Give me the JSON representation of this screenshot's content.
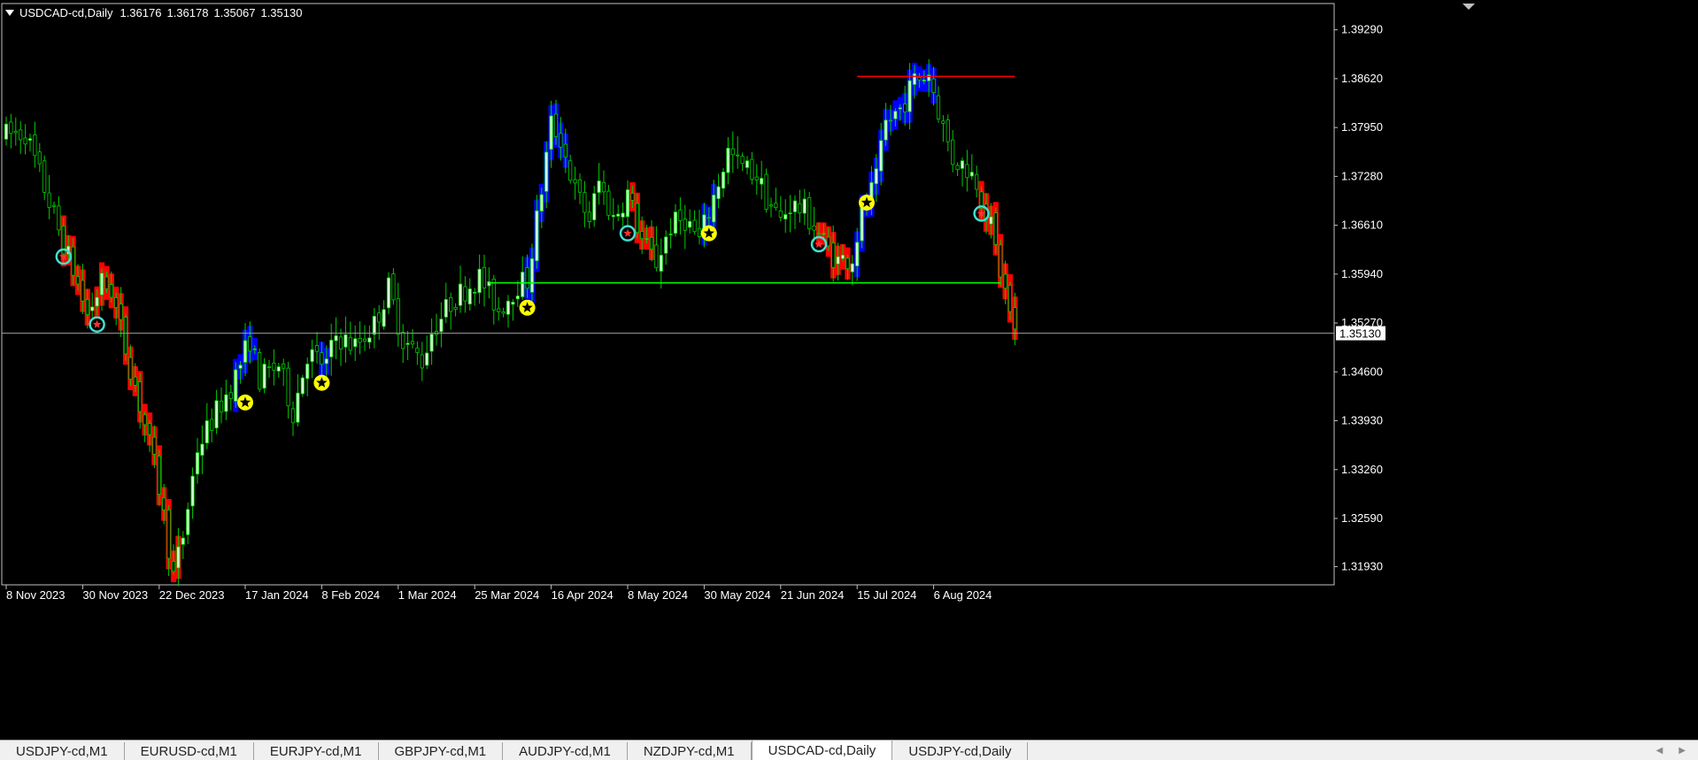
{
  "header": {
    "symbol": "USDCAD-cd,Daily",
    "open": "1.36176",
    "high": "1.36178",
    "low": "1.35067",
    "close": "1.35130"
  },
  "price_axis": {
    "labels": [
      "1.39290",
      "1.38620",
      "1.37950",
      "1.37280",
      "1.36610",
      "1.35940",
      "1.35270",
      "1.34600",
      "1.33930",
      "1.33260",
      "1.32590",
      "1.31930"
    ],
    "current_price": "1.35130"
  },
  "time_axis": {
    "labels": [
      "8 Nov 2023",
      "30 Nov 2023",
      "22 Dec 2023",
      "17 Jan 2024",
      "8 Feb 2024",
      "1 Mar 2024",
      "25 Mar 2024",
      "16 Apr 2024",
      "8 May 2024",
      "30 May 2024",
      "21 Jun 2024",
      "15 Jul 2024",
      "6 Aug 2024"
    ]
  },
  "tabs": [
    {
      "label": "USDJPY-cd,M1",
      "active": false
    },
    {
      "label": "EURUSD-cd,M1",
      "active": false
    },
    {
      "label": "EURJPY-cd,M1",
      "active": false
    },
    {
      "label": "GBPJPY-cd,M1",
      "active": false
    },
    {
      "label": "AUDJPY-cd,M1",
      "active": false
    },
    {
      "label": "NZDJPY-cd,M1",
      "active": false
    },
    {
      "label": "USDCAD-cd,Daily",
      "active": true
    },
    {
      "label": "USDJPY-cd,Daily",
      "active": false
    }
  ],
  "tab_scroll": {
    "left_icon": "◀",
    "right_icon": "▶"
  },
  "colors": {
    "bull_candle": "#ccffcc",
    "bear_candle": "#000000",
    "wick": "#00cc00",
    "up_zone": "#0000ff",
    "down_zone": "#ff0000",
    "support_line": "#00ff00",
    "resistance_line": "#ff0000",
    "price_line": "#a0a0a0",
    "buy_signal": "#ffff00",
    "sell_signal": "#40e0d0"
  },
  "chart_data": {
    "type": "candlestick",
    "symbol": "USDCAD-cd",
    "timeframe": "Daily",
    "ylim": [
      1.3168,
      1.3965
    ],
    "date_range": [
      "2023-11-08",
      "2024-08-29"
    ],
    "anchors": [
      [
        "2023-11-08",
        1.3785
      ],
      [
        "2023-11-14",
        1.3788
      ],
      [
        "2023-11-20",
        1.3712
      ],
      [
        "2023-11-24",
        1.3635
      ],
      [
        "2023-11-28",
        1.36
      ],
      [
        "2023-12-01",
        1.3538
      ],
      [
        "2023-12-06",
        1.3582
      ],
      [
        "2023-12-08",
        1.3572
      ],
      [
        "2023-12-12",
        1.3518
      ],
      [
        "2023-12-15",
        1.3442
      ],
      [
        "2023-12-19",
        1.3388
      ],
      [
        "2023-12-22",
        1.3302
      ],
      [
        "2023-12-27",
        1.318
      ],
      [
        "2023-12-29",
        1.3235
      ],
      [
        "2024-01-03",
        1.3355
      ],
      [
        "2024-01-09",
        1.3405
      ],
      [
        "2024-01-12",
        1.344
      ],
      [
        "2024-01-15",
        1.3455
      ],
      [
        "2024-01-18",
        1.3505
      ],
      [
        "2024-01-22",
        1.345
      ],
      [
        "2024-01-26",
        1.347
      ],
      [
        "2024-01-31",
        1.3405
      ],
      [
        "2024-02-05",
        1.3485
      ],
      [
        "2024-02-09",
        1.347
      ],
      [
        "2024-02-13",
        1.351
      ],
      [
        "2024-02-19",
        1.3495
      ],
      [
        "2024-02-23",
        1.3525
      ],
      [
        "2024-02-28",
        1.3575
      ],
      [
        "2024-03-04",
        1.3505
      ],
      [
        "2024-03-08",
        1.3475
      ],
      [
        "2024-03-12",
        1.3515
      ],
      [
        "2024-03-18",
        1.3555
      ],
      [
        "2024-03-22",
        1.358
      ],
      [
        "2024-03-26",
        1.359
      ],
      [
        "2024-04-01",
        1.3545
      ],
      [
        "2024-04-05",
        1.358
      ],
      [
        "2024-04-09",
        1.3585
      ],
      [
        "2024-04-12",
        1.371
      ],
      [
        "2024-04-16",
        1.38
      ],
      [
        "2024-04-18",
        1.378
      ],
      [
        "2024-04-23",
        1.3708
      ],
      [
        "2024-04-26",
        1.367
      ],
      [
        "2024-04-30",
        1.372
      ],
      [
        "2024-05-03",
        1.367
      ],
      [
        "2024-05-08",
        1.3705
      ],
      [
        "2024-05-13",
        1.364
      ],
      [
        "2024-05-16",
        1.361
      ],
      [
        "2024-05-21",
        1.366
      ],
      [
        "2024-05-24",
        1.367
      ],
      [
        "2024-05-29",
        1.364
      ],
      [
        "2024-06-03",
        1.37
      ],
      [
        "2024-06-06",
        1.3762
      ],
      [
        "2024-06-10",
        1.3745
      ],
      [
        "2024-06-14",
        1.373
      ],
      [
        "2024-06-18",
        1.3698
      ],
      [
        "2024-06-21",
        1.3668
      ],
      [
        "2024-06-25",
        1.369
      ],
      [
        "2024-06-28",
        1.368
      ],
      [
        "2024-07-02",
        1.366
      ],
      [
        "2024-07-05",
        1.3628
      ],
      [
        "2024-07-09",
        1.3612
      ],
      [
        "2024-07-12",
        1.3618
      ],
      [
        "2024-07-16",
        1.3675
      ],
      [
        "2024-07-19",
        1.3722
      ],
      [
        "2024-07-23",
        1.38
      ],
      [
        "2024-07-26",
        1.382
      ],
      [
        "2024-07-31",
        1.386
      ],
      [
        "2024-08-05",
        1.387
      ],
      [
        "2024-08-08",
        1.3795
      ],
      [
        "2024-08-12",
        1.3752
      ],
      [
        "2024-08-15",
        1.374
      ],
      [
        "2024-08-19",
        1.3722
      ],
      [
        "2024-08-22",
        1.3658
      ],
      [
        "2024-08-26",
        1.3598
      ],
      [
        "2024-08-29",
        1.3513
      ]
    ],
    "support": {
      "price": 1.3582,
      "from": "2024-03-28",
      "to": "2024-08-26"
    },
    "resistance": {
      "price": 1.3865,
      "from": "2024-07-15",
      "to": "2024-08-29"
    },
    "current_price": 1.3513,
    "up_zones": [
      [
        "2024-01-15",
        "2024-01-19"
      ],
      [
        "2024-02-08",
        "2024-02-09"
      ],
      [
        "2024-04-09",
        "2024-04-19"
      ],
      [
        "2024-05-30",
        "2024-06-03"
      ],
      [
        "2024-07-15",
        "2024-08-06"
      ]
    ],
    "down_zones": [
      [
        "2023-11-24",
        "2023-12-01"
      ],
      [
        "2023-12-05",
        "2023-12-28"
      ],
      [
        "2024-05-09",
        "2024-05-15"
      ],
      [
        "2024-07-03",
        "2024-07-11"
      ],
      [
        "2024-08-20",
        "2024-08-29"
      ]
    ],
    "buy_signals": [
      {
        "date": "2024-01-17",
        "price": 1.3418
      },
      {
        "date": "2024-02-08",
        "price": 1.3445
      },
      {
        "date": "2024-04-09",
        "price": 1.3548
      },
      {
        "date": "2024-05-31",
        "price": 1.365
      },
      {
        "date": "2024-07-17",
        "price": 1.3692
      }
    ],
    "sell_signals": [
      {
        "date": "2023-11-24",
        "price": 1.3618
      },
      {
        "date": "2023-12-05",
        "price": 1.3525
      },
      {
        "date": "2024-05-08",
        "price": 1.365
      },
      {
        "date": "2024-07-03",
        "price": 1.3635
      },
      {
        "date": "2024-08-20",
        "price": 1.3677
      }
    ]
  }
}
